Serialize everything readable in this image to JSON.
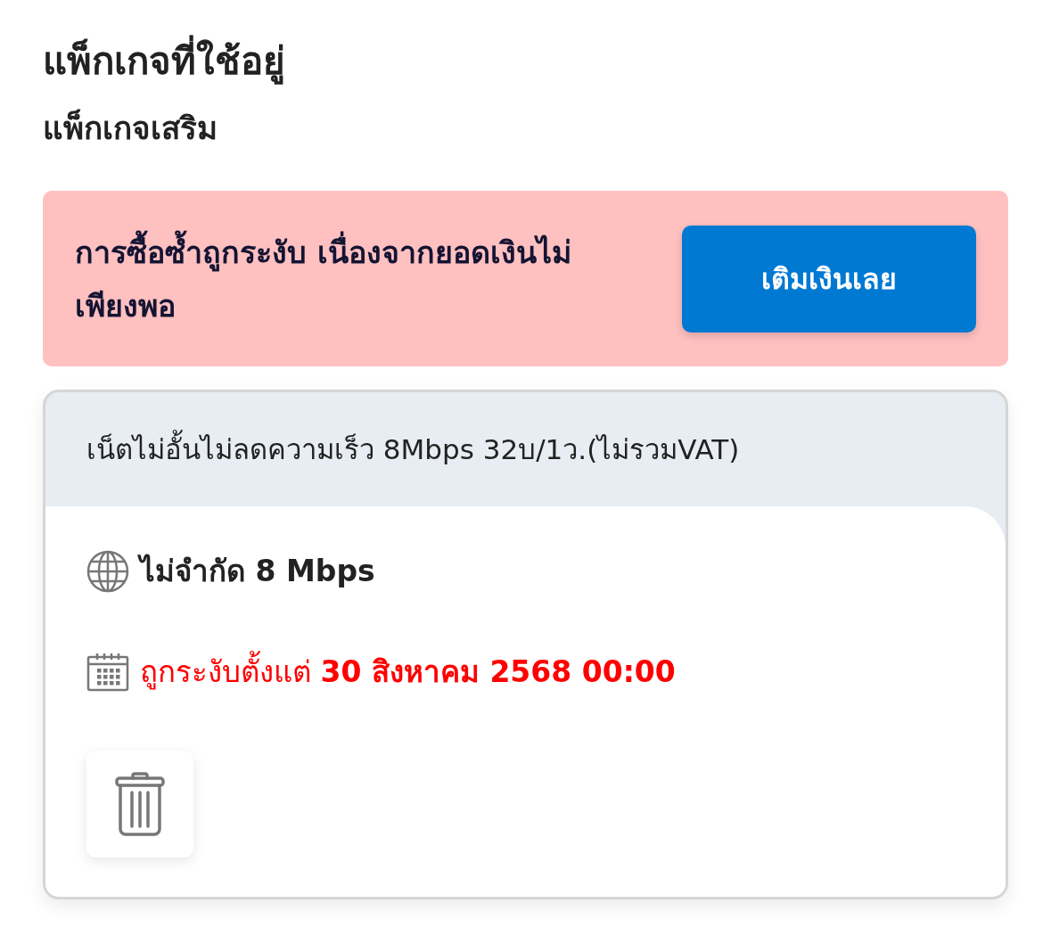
{
  "page": {
    "title": "แพ็กเกจที่ใช้อยู่",
    "subtitle": "แพ็กเกจเสริม"
  },
  "alert": {
    "message": "การซื้อซ้ำถูกระงับ เนื่องจากยอดเงินไม่เพียงพอ",
    "button": "เติมเงินเลย"
  },
  "package": {
    "name": "เน็ตไม่อั้นไม่ลดความเร็ว 8Mbps 32บ/1ว.(ไม่รวมVAT)",
    "details": [
      {
        "kind": "speed",
        "text": "ไม่จำกัด 8 Mbps"
      },
      {
        "kind": "suspended",
        "text": "ถูกระงับตั้งแต่ **30 สิงหาคม 2568 00:00**"
      }
    ],
    "actions": [
      {
        "kind": "delete"
      }
    ]
  }
}
